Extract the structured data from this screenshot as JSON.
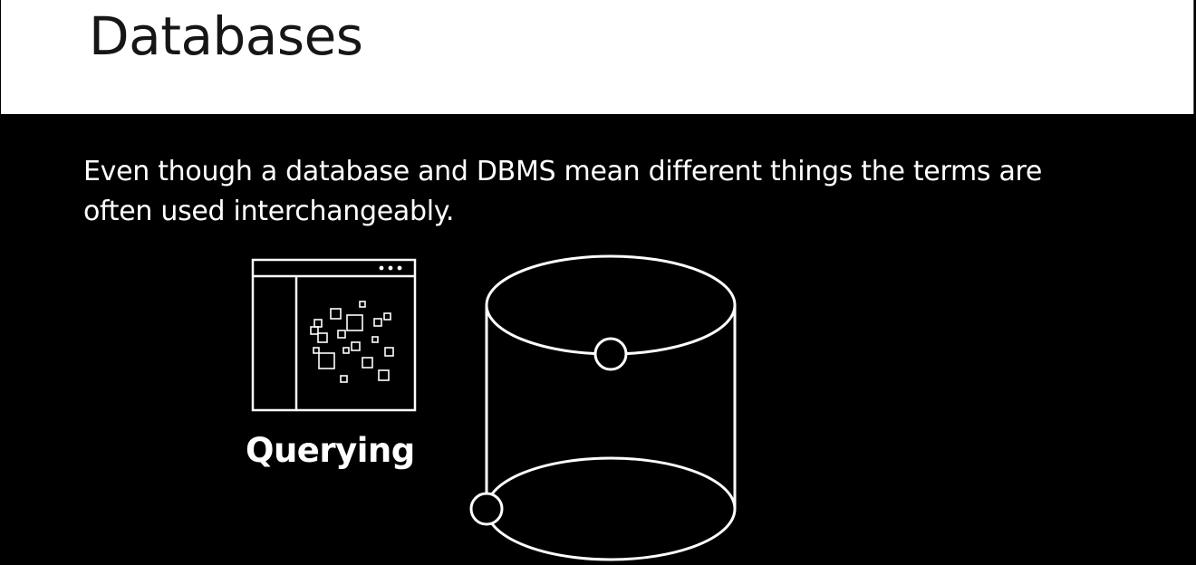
{
  "slide": {
    "title": "Databases",
    "body": "Even though a database and DBMS mean different things the terms are often used interchangeably.",
    "caption": "Querying"
  },
  "colors": {
    "background": "#000000",
    "title_bar": "#ffffff",
    "title_text": "#161616",
    "foreground": "#ffffff"
  },
  "icons": {
    "query_window": "query-window-icon",
    "database": "database-cylinder-icon"
  }
}
